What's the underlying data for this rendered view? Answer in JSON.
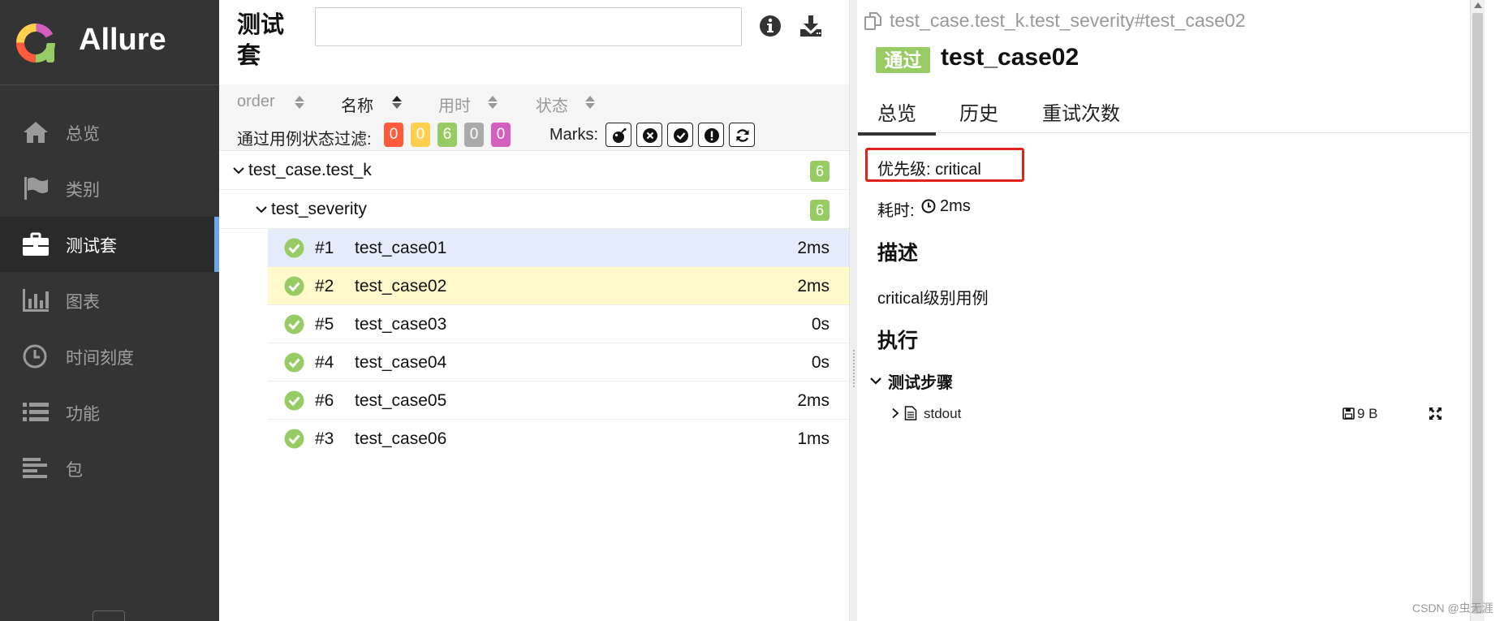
{
  "app": {
    "name": "Allure",
    "logo_icon": "allure-logo-icon"
  },
  "sidebar": {
    "items": [
      {
        "label": "总览",
        "icon": "home-icon"
      },
      {
        "label": "类别",
        "icon": "flag-icon"
      },
      {
        "label": "测试套",
        "icon": "briefcase-icon",
        "active": true
      },
      {
        "label": "图表",
        "icon": "bar-chart-icon"
      },
      {
        "label": "时间刻度",
        "icon": "clock-icon"
      },
      {
        "label": "功能",
        "icon": "list-icon"
      },
      {
        "label": "包",
        "icon": "align-left-icon"
      }
    ]
  },
  "suites": {
    "title": "测试套",
    "search": {
      "value": "",
      "placeholder": ""
    },
    "sort": {
      "columns": [
        {
          "label": "order"
        },
        {
          "label": "名称",
          "active": true
        },
        {
          "label": "用时"
        },
        {
          "label": "状态"
        }
      ]
    },
    "filter": {
      "label": "通过用例状态过滤:",
      "badges": [
        {
          "value": "0",
          "color": "#fd5a3e"
        },
        {
          "value": "0",
          "color": "#ffd050"
        },
        {
          "value": "6",
          "color": "#97cc64"
        },
        {
          "value": "0",
          "color": "#aaaaaa"
        },
        {
          "value": "0",
          "color": "#d35ebe"
        }
      ],
      "marks_label": "Marks:",
      "marks": [
        "bomb-icon",
        "times-circle-icon",
        "check-circle-icon",
        "exclamation-circle-icon",
        "refresh-icon"
      ]
    },
    "tree": {
      "suite": {
        "name": "test_case.test_k",
        "count": "6"
      },
      "subsuite": {
        "name": "test_severity",
        "count": "6"
      },
      "cases": [
        {
          "order": "#1",
          "name": "test_case01",
          "duration": "2ms"
        },
        {
          "order": "#2",
          "name": "test_case02",
          "duration": "2ms"
        },
        {
          "order": "#5",
          "name": "test_case03",
          "duration": "0s"
        },
        {
          "order": "#4",
          "name": "test_case04",
          "duration": "0s"
        },
        {
          "order": "#6",
          "name": "test_case05",
          "duration": "2ms"
        },
        {
          "order": "#3",
          "name": "test_case06",
          "duration": "1ms"
        }
      ]
    }
  },
  "detail": {
    "breadcrumb": "test_case.test_k.test_severity#test_case02",
    "status": "通过",
    "title": "test_case02",
    "tabs": [
      {
        "label": "总览"
      },
      {
        "label": "历史"
      },
      {
        "label": "重试次数"
      }
    ],
    "priority": "优先级: critical",
    "duration_label": "耗时:",
    "duration_value": "2ms",
    "description_heading": "描述",
    "description": "critical级别用例",
    "execution_heading": "执行",
    "steps_heading": "测试步骤",
    "step": {
      "name": "stdout",
      "size": "9 B"
    }
  },
  "watermark": "CSDN @虫无涯",
  "colors": {
    "passed": "#97cc64",
    "sidebar": "#343434",
    "accent": "#6aa6e8",
    "highlight_border": "#e2231a"
  }
}
